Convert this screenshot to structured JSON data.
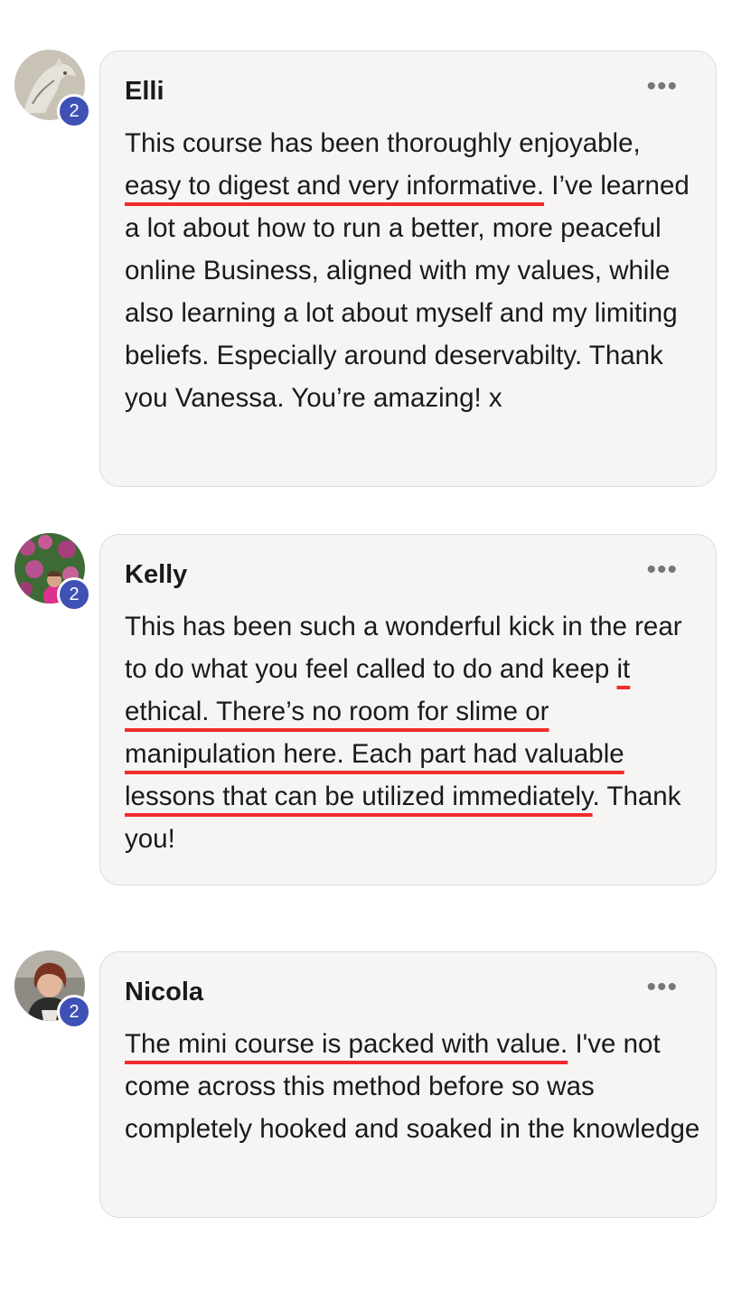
{
  "comments": [
    {
      "author": "Elli",
      "badge": "2",
      "segments": [
        {
          "text": "This course has been thoroughly enjoyable, ",
          "underline": false
        },
        {
          "text": "easy to digest and very informative.",
          "underline": true
        },
        {
          "text": " I’ve learned a lot about how to run a better, more peaceful online Business, aligned with my values, while also learning a lot about myself and my limiting beliefs. Especially around deservabilty. Thank you Vanessa. You’re amazing! x",
          "underline": false
        }
      ]
    },
    {
      "author": "Kelly",
      "badge": "2",
      "segments": [
        {
          "text": "This has been such a wonderful kick in the rear to do what you feel called to do and keep ",
          "underline": false
        },
        {
          "text": "it ethical. There’s no room for slime or manipulation here. Each part had valuable lessons that can be utilized immediately",
          "underline": true
        },
        {
          "text": ". Thank you!",
          "underline": false
        }
      ]
    },
    {
      "author": "Nicola",
      "badge": "2",
      "segments": [
        {
          "text": "The mini course is packed with value.",
          "underline": true
        },
        {
          "text": " I've not come across this method before so was completely hooked and soaked in the knowledge",
          "underline": false
        }
      ]
    }
  ],
  "icons": {
    "more": "more-options-icon"
  },
  "colors": {
    "badge": "#3f51b5",
    "underline": "#f22b2b",
    "bubble_bg": "#f6f5f4"
  }
}
